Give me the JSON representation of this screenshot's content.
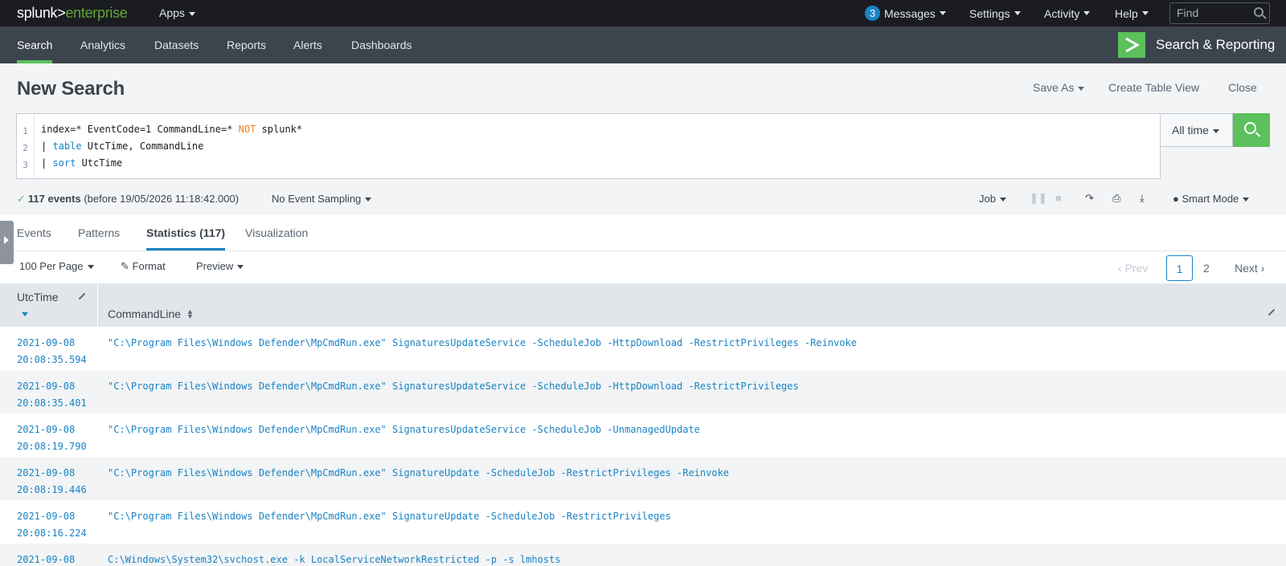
{
  "topbar": {
    "logo_main": "splunk>",
    "logo_sub": "enterprise",
    "apps": "Apps",
    "messages_count": "3",
    "messages": "Messages",
    "settings": "Settings",
    "activity": "Activity",
    "help": "Help",
    "find_placeholder": "Find"
  },
  "appbar": {
    "nav": [
      "Search",
      "Analytics",
      "Datasets",
      "Reports",
      "Alerts",
      "Dashboards"
    ],
    "app_name": "Search & Reporting"
  },
  "page": {
    "title": "New Search",
    "save_as": "Save As",
    "create_table_view": "Create Table View",
    "close": "Close"
  },
  "search": {
    "line_numbers": [
      "1",
      "2",
      "3"
    ],
    "line1_a": "index=* EventCode=1 CommandLine=* ",
    "line1_not": "NOT",
    "line1_b": " splunk*",
    "line2_pipe": "| ",
    "line2_cmd": "table",
    "line2_rest": " UtcTime, CommandLine",
    "line3_pipe": "| ",
    "line3_cmd": "sort",
    "line3_rest": " UtcTime",
    "time_range": "All time"
  },
  "status": {
    "check": "✓",
    "events": "117 events",
    "before": "(before 19/05/2026 11:18:42.000)",
    "sampling": "No Event Sampling",
    "job": "Job",
    "mode": "Smart Mode"
  },
  "tabs": {
    "events": "Events",
    "patterns": "Patterns",
    "statistics": "Statistics (117)",
    "visualization": "Visualization"
  },
  "toolbar": {
    "per_page": "100 Per Page",
    "format": "Format",
    "preview": "Preview"
  },
  "pagination": {
    "prev": "Prev",
    "pages": [
      "1",
      "2"
    ],
    "next": "Next"
  },
  "table": {
    "columns": [
      "UtcTime",
      "CommandLine"
    ],
    "rows": [
      {
        "date": "2021-09-08",
        "time": "20:08:35.594",
        "cmd": "\"C:\\Program Files\\Windows Defender\\MpCmdRun.exe\" SignaturesUpdateService -ScheduleJob -HttpDownload -RestrictPrivileges -Reinvoke"
      },
      {
        "date": "2021-09-08",
        "time": "20:08:35.401",
        "cmd": "\"C:\\Program Files\\Windows Defender\\MpCmdRun.exe\" SignaturesUpdateService -ScheduleJob -HttpDownload -RestrictPrivileges"
      },
      {
        "date": "2021-09-08",
        "time": "20:08:19.790",
        "cmd": "\"C:\\Program Files\\Windows Defender\\MpCmdRun.exe\" SignaturesUpdateService -ScheduleJob -UnmanagedUpdate"
      },
      {
        "date": "2021-09-08",
        "time": "20:08:19.446",
        "cmd": "\"C:\\Program Files\\Windows Defender\\MpCmdRun.exe\" SignatureUpdate -ScheduleJob -RestrictPrivileges -Reinvoke"
      },
      {
        "date": "2021-09-08",
        "time": "20:08:16.224",
        "cmd": "\"C:\\Program Files\\Windows Defender\\MpCmdRun.exe\" SignatureUpdate -ScheduleJob -RestrictPrivileges"
      },
      {
        "date": "2021-09-08",
        "time": "",
        "cmd": "C:\\Windows\\System32\\svchost.exe -k LocalServiceNetworkRestricted -p -s lmhosts"
      }
    ]
  },
  "colors": {
    "accent_green": "#5cc05c",
    "link_blue": "#1a83c4",
    "topbar_bg": "#1a1c21",
    "appbar_bg": "#3c444d"
  }
}
